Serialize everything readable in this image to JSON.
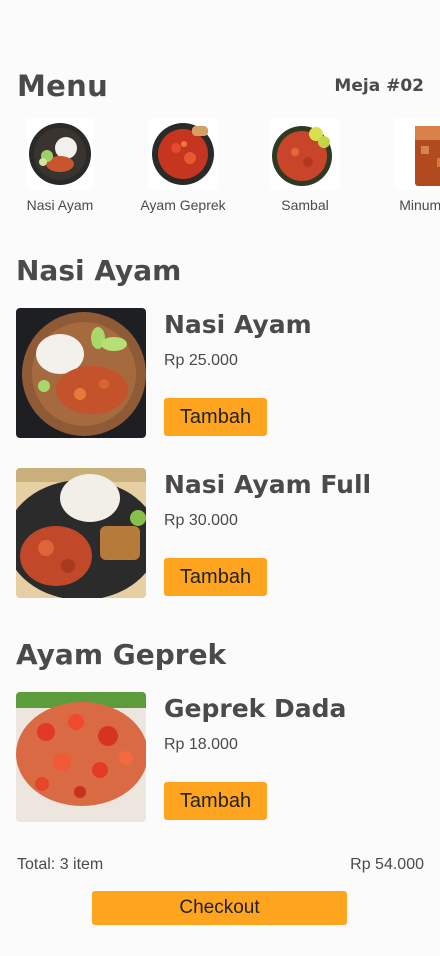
{
  "header": {
    "title": "Menu",
    "table": "Meja #02"
  },
  "categories": [
    {
      "label": "Nasi Ayam",
      "icon": "nasi-ayam-plate-image"
    },
    {
      "label": "Ayam Geprek",
      "icon": "ayam-geprek-plate-image"
    },
    {
      "label": "Sambal",
      "icon": "sambal-bowl-image"
    },
    {
      "label": "Minuman",
      "icon": "iced-tea-glass-image"
    }
  ],
  "sections": [
    {
      "title": "Nasi Ayam",
      "items": [
        {
          "name": "Nasi Ayam",
          "price": "Rp 25.000",
          "button": "Tambah"
        },
        {
          "name": "Nasi Ayam Full",
          "price": "Rp 30.000",
          "button": "Tambah"
        }
      ]
    },
    {
      "title": "Ayam Geprek",
      "items": [
        {
          "name": "Geprek Dada",
          "price": "Rp 18.000",
          "button": "Tambah"
        }
      ]
    }
  ],
  "cart": {
    "total_items": "Total: 3 item",
    "total_price": "Rp 54.000",
    "checkout": "Checkout"
  },
  "colors": {
    "accent": "#ffa41f",
    "text": "#4a4a4a",
    "background": "#fbfbfb"
  }
}
